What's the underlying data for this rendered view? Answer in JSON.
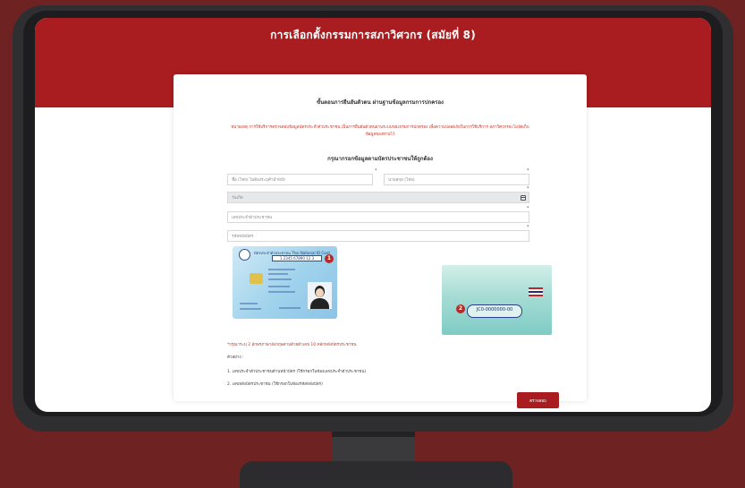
{
  "page": {
    "title": "การเลือกตั้งกรรมการสภาวิศวกร (สมัยที่ 8)"
  },
  "form": {
    "heading": "ขั้นตอนการยืนยันตัวตน ผ่านฐานข้อมูลกรมการปกครอง",
    "notice": "หมายเหตุ การใช้บริการตรวจสอบข้อมูลบัตรประจำตัวประชาชน เป็นการยืนยันตัวตนผ่านระบบของกรมการปกครอง เพื่อความปลอดภัยในการใช้บริการ สภาวิศวกรจะไม่จัดเก็บข้อมูลของท่านไว้",
    "subheading": "กรุณากรอกข้อมูลตามบัตรประชาชนให้ถูกต้อง",
    "fields": {
      "first_name_placeholder": "ชื่อ (ไทย) ไม่ต้องระบุคำนำหน้า",
      "last_name_placeholder": "นามสกุล (ไทย)",
      "birthdate_placeholder": "วันเกิด",
      "id_number_placeholder": "เลขประจำตัวประชาชน",
      "laser_code_placeholder": "รหัสหลังบัตร"
    },
    "id_card": {
      "front_title": "บัตรประจำตัวประชาชน Thai National ID Card",
      "front_number": "1 2345 67890 12 3",
      "front_badge": "1",
      "back_badge": "2",
      "laser_code": "JC0-0000000-00"
    },
    "hint": "*กรุณาระบุ 2 อักษรภาษาอังกฤษตามด้วยตัวเลข 10 หลักหลังบัตรประชาชน",
    "example_label": "ตัวอย่าง :",
    "examples": [
      "1. เลขประจำตัวประชาชนด้านหน้าบัตร (ใช้กรอกในช่องเลขประจำตัวประชาชน)",
      "2. เลขหลังบัตรประชาชน (ใช้กรอกในช่องรหัสหลังบัตร)"
    ],
    "submit_label": "ตรวจสอบ"
  },
  "colors": {
    "brand_red": "#a91c20",
    "background": "#6e2322",
    "monitor": "#2f2f31"
  },
  "icons": {
    "calendar": "calendar-icon"
  }
}
